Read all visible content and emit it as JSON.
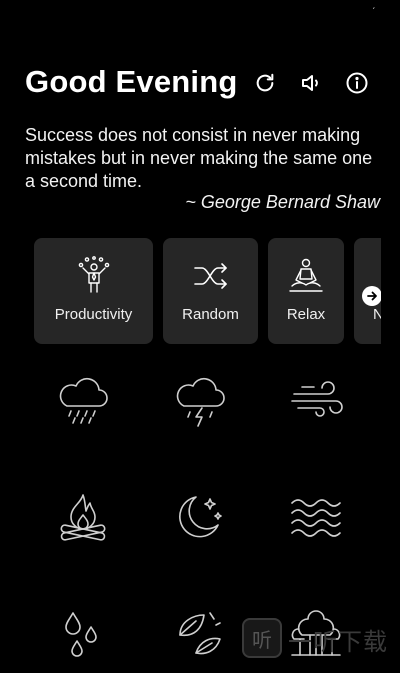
{
  "status": {
    "signal_mark": "ˊ"
  },
  "header": {
    "greeting": "Good Evening",
    "icons": [
      "refresh-icon",
      "volume-icon",
      "info-icon"
    ]
  },
  "quote": {
    "text": "Success does not consist in never making mistakes but in never making the same one a second time.",
    "author": "~ George Bernard Shaw"
  },
  "categories": [
    {
      "label": "Productivity",
      "icon": "juggler-icon"
    },
    {
      "label": "Random",
      "icon": "shuffle-icon"
    },
    {
      "label": "Relax",
      "icon": "meditation-icon"
    },
    {
      "label": "N",
      "icon": "arrow-right-icon"
    }
  ],
  "sounds": [
    {
      "name": "rain",
      "icon": "rain-cloud-icon"
    },
    {
      "name": "thunderstorm",
      "icon": "storm-cloud-icon"
    },
    {
      "name": "wind",
      "icon": "wind-icon"
    },
    {
      "name": "campfire",
      "icon": "campfire-icon"
    },
    {
      "name": "night",
      "icon": "moon-stars-icon"
    },
    {
      "name": "waves",
      "icon": "waves-icon"
    },
    {
      "name": "drops",
      "icon": "water-drops-icon"
    },
    {
      "name": "leaves",
      "icon": "leaves-icon"
    },
    {
      "name": "forest",
      "icon": "forest-icon"
    }
  ],
  "watermark": {
    "logo_glyph": "听",
    "text": "一听下载"
  },
  "colors": {
    "background": "#000000",
    "card": "#262626",
    "icon_stroke": "#ffffff",
    "sound_icon": "#cfcfcf"
  }
}
